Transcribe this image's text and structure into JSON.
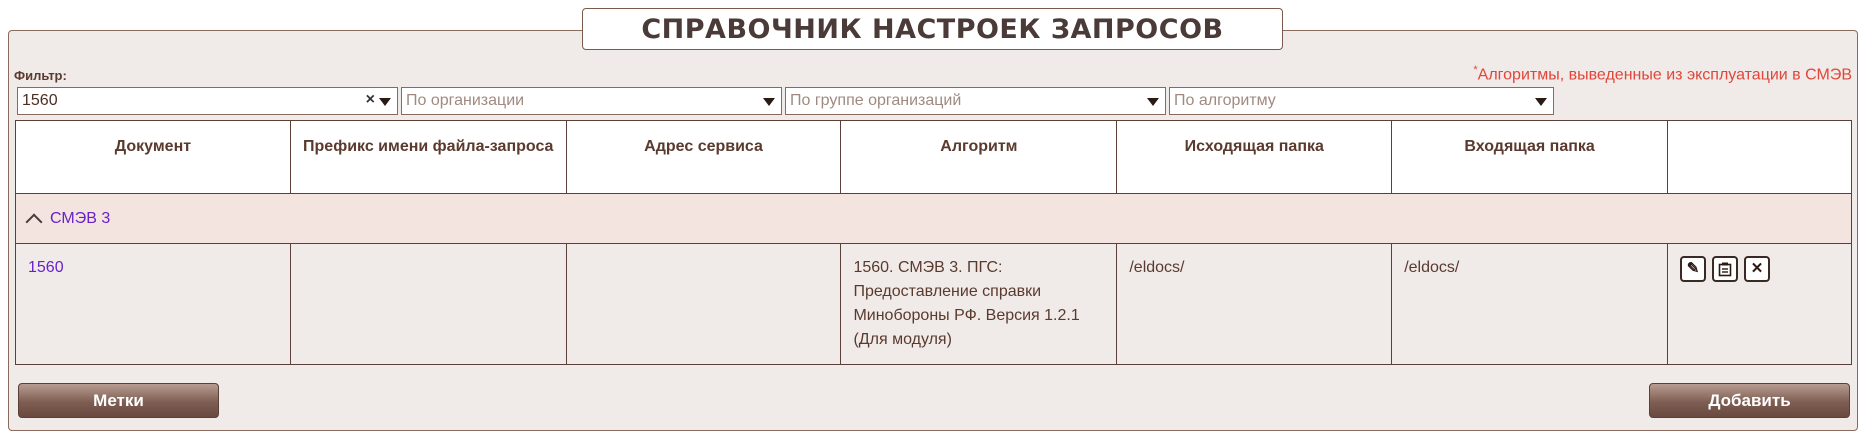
{
  "title": "СПРАВОЧНИК НАСТРОЕК ЗАПРОСОВ",
  "filter_label": "Фильтр:",
  "note": {
    "mark": "*",
    "text": "Алгоритмы, выведенные из эксплуатации в СМЭВ",
    "color": "#e0463a"
  },
  "filters": {
    "document": {
      "value": "1560",
      "clear_icon": "×"
    },
    "organization": {
      "placeholder": "По организации"
    },
    "org_group": {
      "placeholder": "По группе организаций"
    },
    "algorithm": {
      "placeholder": "По алгоритму"
    }
  },
  "table": {
    "columns": [
      "Документ",
      "Префикс имени файла-запроса",
      "Адрес сервиса",
      "Алгоритм",
      "Исходящая папка",
      "Входящая папка",
      ""
    ],
    "group": {
      "label": "СМЭВ 3",
      "icon": "chevron-up-icon"
    },
    "rows": [
      {
        "document": "1560",
        "prefix": "",
        "address": "",
        "algorithm": "1560. СМЭВ 3. ПГС: Предоставление справки Минобороны РФ. Версия 1.2.1 (Для модуля)",
        "out_folder": "/eldocs/",
        "in_folder": "/eldocs/"
      }
    ],
    "row_actions": [
      {
        "name": "edit-icon",
        "glyph": "✎"
      },
      {
        "name": "copy-icon",
        "glyph": "📋"
      },
      {
        "name": "delete-icon",
        "glyph": "✕"
      }
    ]
  },
  "buttons": {
    "tags": "Метки",
    "add": "Добавить"
  },
  "colors": {
    "link": "#6a22c8",
    "group_bg": "#f3e4df",
    "panel_bg": "#f0ebe8"
  }
}
